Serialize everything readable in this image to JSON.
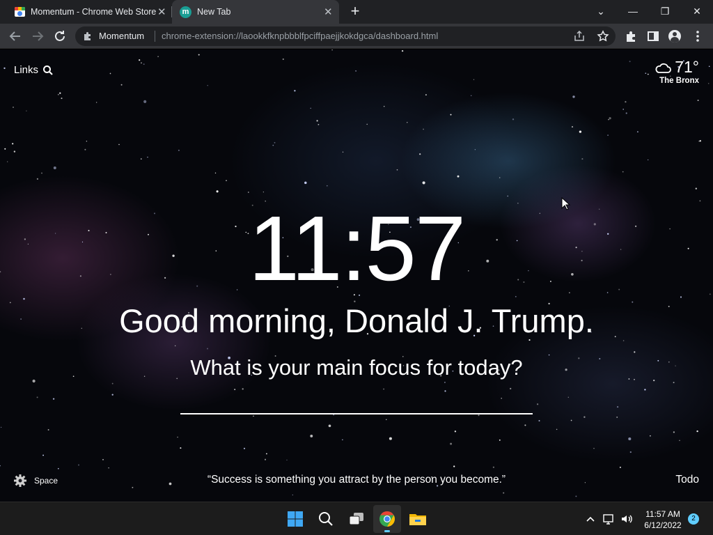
{
  "browser": {
    "tabs": [
      {
        "title": "Momentum - Chrome Web Store",
        "active": false
      },
      {
        "title": "New Tab",
        "active": true
      }
    ],
    "new_tab_symbol": "+",
    "window_controls": {
      "tabsearch": "⌄",
      "minimize": "—",
      "restore": "❐",
      "close": "✕"
    },
    "omnibox": {
      "chip_label": "Momentum",
      "url": "chrome-extension://laookkfknpbbblfpciffpaejjkokdgca/dashboard.html"
    }
  },
  "dashboard": {
    "links_label": "Links",
    "weather": {
      "temperature": "71°",
      "location": "The Bronx",
      "condition_icon": "cloud-icon"
    },
    "clock": "11:57",
    "greeting": "Good morning, Donald J. Trump.",
    "focus_prompt": "What is your main focus for today?",
    "focus_value": "",
    "settings_label": "Space",
    "quote": "“Success is something you attract by the person you become.”",
    "todo_label": "Todo"
  },
  "taskbar": {
    "apps": [
      "windows-start",
      "search",
      "task-view",
      "chrome",
      "file-explorer"
    ],
    "active_app": "chrome",
    "tray": {
      "time": "11:57 AM",
      "date": "6/12/2022",
      "notifications": "2"
    }
  },
  "colors": {
    "tabstrip": "#202124",
    "toolbar": "#35363a",
    "taskbar": "#1c1c1c",
    "accent": "#60cdff",
    "momentum_favicon": "#1a9e94"
  }
}
